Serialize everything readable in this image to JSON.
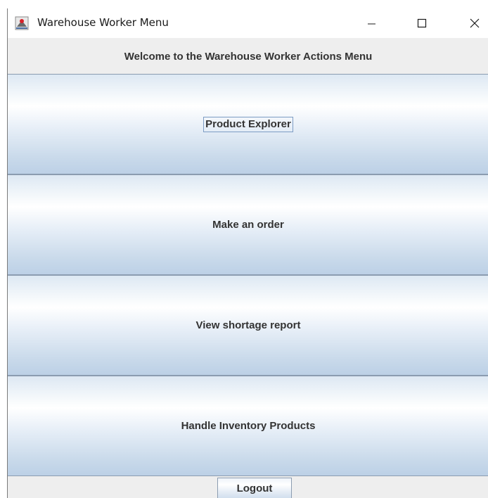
{
  "window": {
    "title": "Warehouse Worker Menu",
    "icon": "java-app-icon"
  },
  "header": {
    "welcome": "Welcome to the Warehouse Worker Actions Menu"
  },
  "menu": {
    "items": [
      {
        "label": "Product Explorer",
        "focused": true
      },
      {
        "label": "Make an order",
        "focused": false
      },
      {
        "label": "View shortage report",
        "focused": false
      },
      {
        "label": "Handle Inventory Products",
        "focused": false
      }
    ]
  },
  "footer": {
    "logout_label": "Logout"
  },
  "colors": {
    "button_border": "#8b9cb0",
    "button_gradient_light": "#ffffff",
    "button_gradient_dark": "#bcd0e6",
    "text": "#333333",
    "panel_bg": "#eeeeee"
  }
}
